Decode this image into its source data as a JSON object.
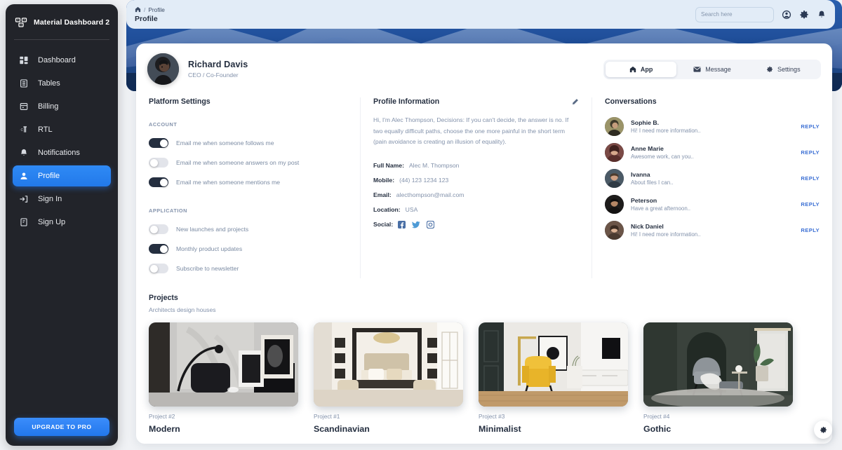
{
  "sidebar": {
    "brand": {
      "name": "Material Dashboard 2",
      "logo_icon": "dashboard-logo-icon"
    },
    "items": [
      {
        "label": "Dashboard",
        "icon": "dashboard-icon",
        "active": false
      },
      {
        "label": "Tables",
        "icon": "tables-icon",
        "active": false
      },
      {
        "label": "Billing",
        "icon": "billing-icon",
        "active": false
      },
      {
        "label": "RTL",
        "icon": "rtl-icon",
        "active": false
      },
      {
        "label": "Notifications",
        "icon": "bell-icon",
        "active": false
      },
      {
        "label": "Profile",
        "icon": "person-icon",
        "active": true
      },
      {
        "label": "Sign In",
        "icon": "sign-in-icon",
        "active": false
      },
      {
        "label": "Sign Up",
        "icon": "sign-up-icon",
        "active": false
      }
    ],
    "upgrade_label": "UPGRADE TO PRO"
  },
  "topbar": {
    "breadcrumb_home_icon": "home-icon",
    "breadcrumb_separator": "/",
    "breadcrumb_current": "Profile",
    "page_title": "Profile",
    "search_placeholder": "Search here",
    "search_value": "",
    "icons": [
      "account-icon",
      "gear-icon",
      "bell-icon"
    ]
  },
  "profile": {
    "name": "Richard Davis",
    "role": "CEO / Co-Founder",
    "tabs": [
      {
        "label": "App",
        "icon": "home-icon",
        "active": true
      },
      {
        "label": "Message",
        "icon": "mail-icon",
        "active": false
      },
      {
        "label": "Settings",
        "icon": "gear-icon",
        "active": false
      }
    ]
  },
  "platform_settings": {
    "title": "Platform Settings",
    "groups": [
      {
        "label": "ACCOUNT",
        "options": [
          {
            "label": "Email me when someone follows me",
            "on": true
          },
          {
            "label": "Email me when someone answers on my post",
            "on": false
          },
          {
            "label": "Email me when someone mentions me",
            "on": true
          }
        ]
      },
      {
        "label": "APPLICATION",
        "options": [
          {
            "label": "New launches and projects",
            "on": false
          },
          {
            "label": "Monthly product updates",
            "on": true
          },
          {
            "label": "Subscribe to newsletter",
            "on": false
          }
        ]
      }
    ]
  },
  "profile_information": {
    "title": "Profile Information",
    "edit_icon": "pencil-icon",
    "bio": "Hi, I'm Alec Thompson, Decisions: If you can't decide, the answer is no. If two equally difficult paths, choose the one more painful in the short term (pain avoidance is creating an illusion of equality).",
    "fields": [
      {
        "key": "Full Name:",
        "value": "Alec M. Thompson"
      },
      {
        "key": "Mobile:",
        "value": "(44) 123 1234 123"
      },
      {
        "key": "Email:",
        "value": "alecthompson@mail.com"
      },
      {
        "key": "Location:",
        "value": "USA"
      }
    ],
    "social_label": "Social:",
    "socials": [
      "facebook-icon",
      "twitter-icon",
      "instagram-icon"
    ]
  },
  "conversations": {
    "title": "Conversations",
    "reply_label": "REPLY",
    "items": [
      {
        "name": "Sophie B.",
        "message": "Hi! I need more information..",
        "avatar_tone": "#8d8a63"
      },
      {
        "name": "Anne Marie",
        "message": "Awesome work, can you..",
        "avatar_tone": "#7b4a46"
      },
      {
        "name": "Ivanna",
        "message": "About files I can..",
        "avatar_tone": "#4b5a66"
      },
      {
        "name": "Peterson",
        "message": "Have a great afternoon..",
        "avatar_tone": "#2e2a28"
      },
      {
        "name": "Nick Daniel",
        "message": "Hi! I need more information..",
        "avatar_tone": "#6b5548"
      }
    ]
  },
  "projects": {
    "title": "Projects",
    "subtitle": "Architects design houses",
    "items": [
      {
        "number": "Project #2",
        "name": "Modern",
        "theme": "modern"
      },
      {
        "number": "Project #1",
        "name": "Scandinavian",
        "theme": "scandinavian"
      },
      {
        "number": "Project #3",
        "name": "Minimalist",
        "theme": "minimalist"
      },
      {
        "number": "Project #4",
        "name": "Gothic",
        "theme": "gothic"
      }
    ]
  },
  "fab": {
    "icon": "gear-icon"
  },
  "colors": {
    "accent_blue": "#2277ec",
    "sidebar_bg": "#22242a",
    "hero_blue": "#19468f",
    "text_dark": "#252f40",
    "text_muted": "#8392ab",
    "reply_blue": "#3b6fd4"
  }
}
